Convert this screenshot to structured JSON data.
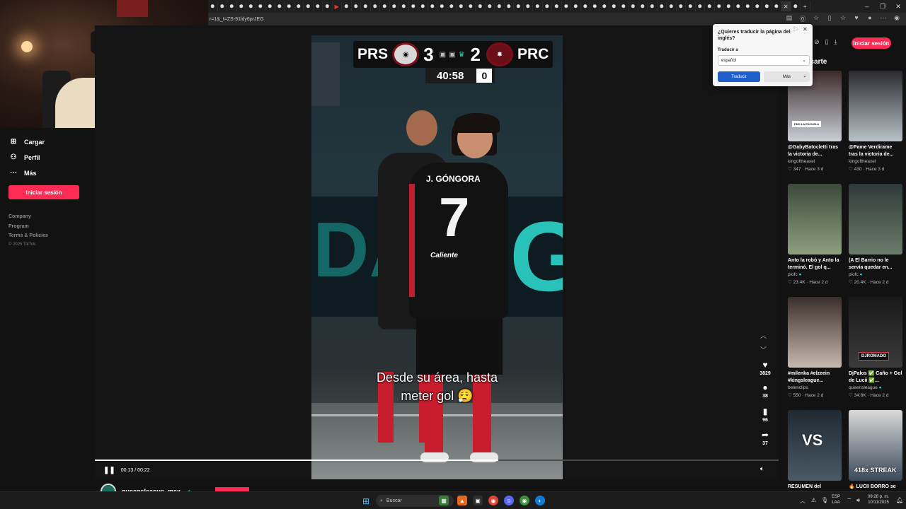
{
  "browser": {
    "url": "r=1&_t=ZS-91ldy6prJEG",
    "tab_count": 62,
    "window_buttons": [
      "–",
      "❐",
      "✕"
    ]
  },
  "translate_popup": {
    "question": "¿Quieres traducir la página del inglés?",
    "translate_to_label": "Traducir a",
    "language_value": "español",
    "translate_button": "Traducir",
    "more_button": "Más"
  },
  "left_nav": {
    "items": [
      {
        "label": "Cargar",
        "icon": "upload-icon",
        "glyph": "⊞"
      },
      {
        "label": "Perfil",
        "icon": "profile-icon",
        "glyph": "👤"
      },
      {
        "label": "Más",
        "icon": "more-icon",
        "glyph": "⋯"
      }
    ],
    "login_button": "Iniciar sesión",
    "footer_links": [
      "Company",
      "Program",
      "Terms & Policies"
    ],
    "copyright": "© 2025 TikTok"
  },
  "header": {
    "login_button": "Iniciar sesión",
    "section_title": "nteresarte"
  },
  "scoreboard": {
    "home_team": "PRS",
    "home_score": "3",
    "away_score": "2",
    "away_team": "PRC",
    "clock": "40:58",
    "extra": "0"
  },
  "video": {
    "caption_line1": "Desde su área, hasta",
    "caption_line2": "meter gol 😮‍💨",
    "jersey_name": "J. GÓNGORA",
    "jersey_number": "7",
    "jersey_sponsor": "Caliente",
    "led_text": "G",
    "time_current": "00:13",
    "time_total": "00:22",
    "time_display": "00:13 / 00:22",
    "progress": 0.59,
    "author": "queensleague_mex"
  },
  "actions": {
    "likes": "3829",
    "comments": "38",
    "saves": "96",
    "shares": "37"
  },
  "related": [
    {
      "title": "@GabyBatocletti tras la victoria de...",
      "author": "kingoftheaxel",
      "likes": "347",
      "age": "Hace 3 d",
      "verified": false,
      "thumb_colors": [
        "#3c2a2a",
        "#c9d0d6"
      ],
      "tag": "PMS LA ESCUELA"
    },
    {
      "title": "@Pame Verdirame tras la victoria de...",
      "author": "kingoftheaxel",
      "likes": "430",
      "age": "Hace 3 d",
      "verified": false,
      "thumb_colors": [
        "#2a2a2e",
        "#b9c2c8"
      ],
      "tag": ""
    },
    {
      "title": "Anto la robó y Anto la terminó. El gol q...",
      "author": "piofc",
      "likes": "23.4K",
      "age": "Hace 2 d",
      "verified": true,
      "thumb_colors": [
        "#3b4a3a",
        "#8fa07e"
      ],
      "tag": ""
    },
    {
      "title": "(A El Barrio no le servía quedar en...",
      "author": "piofc",
      "likes": "20.4K",
      "age": "Hace 2 d",
      "verified": true,
      "thumb_colors": [
        "#2f3a3a",
        "#6b7c6a"
      ],
      "tag": ""
    },
    {
      "title": "#milenka #elzeein #kingsleague...",
      "author": "belenclips",
      "likes": "550",
      "age": "Hace 2 d",
      "verified": false,
      "thumb_colors": [
        "#3a2e2a",
        "#c8b9ae"
      ],
      "tag": ""
    },
    {
      "title": "DjPalos ✅ Caño + Gol de Lucii ✅...",
      "author": "queensleague",
      "likes": "34.8K",
      "age": "Hace 2 d",
      "verified": true,
      "thumb_colors": [
        "#1a1a1a",
        "#3a3a3a"
      ],
      "tag": "DJROMADO"
    },
    {
      "title": "RESUMEN del",
      "author": "",
      "likes": "",
      "age": "",
      "verified": false,
      "thumb_colors": [
        "#1f2a33",
        "#4a5a66"
      ],
      "tag": "VS"
    },
    {
      "title": "🔥 LUCII BORRO se",
      "author": "",
      "likes": "",
      "age": "",
      "verified": false,
      "thumb_colors": [
        "#d9d9d9",
        "#3a4a5a"
      ],
      "tag": "418x STREAK"
    }
  ],
  "taskbar": {
    "search_placeholder": "Buscar",
    "lang_top": "ESP",
    "lang_bottom": "LAA",
    "time": "09:28 p. m.",
    "date": "10/11/2025"
  },
  "colors": {
    "accent": "#fe2c55",
    "translate_blue": "#1f5fcc",
    "led_teal": "#28c2b8"
  }
}
